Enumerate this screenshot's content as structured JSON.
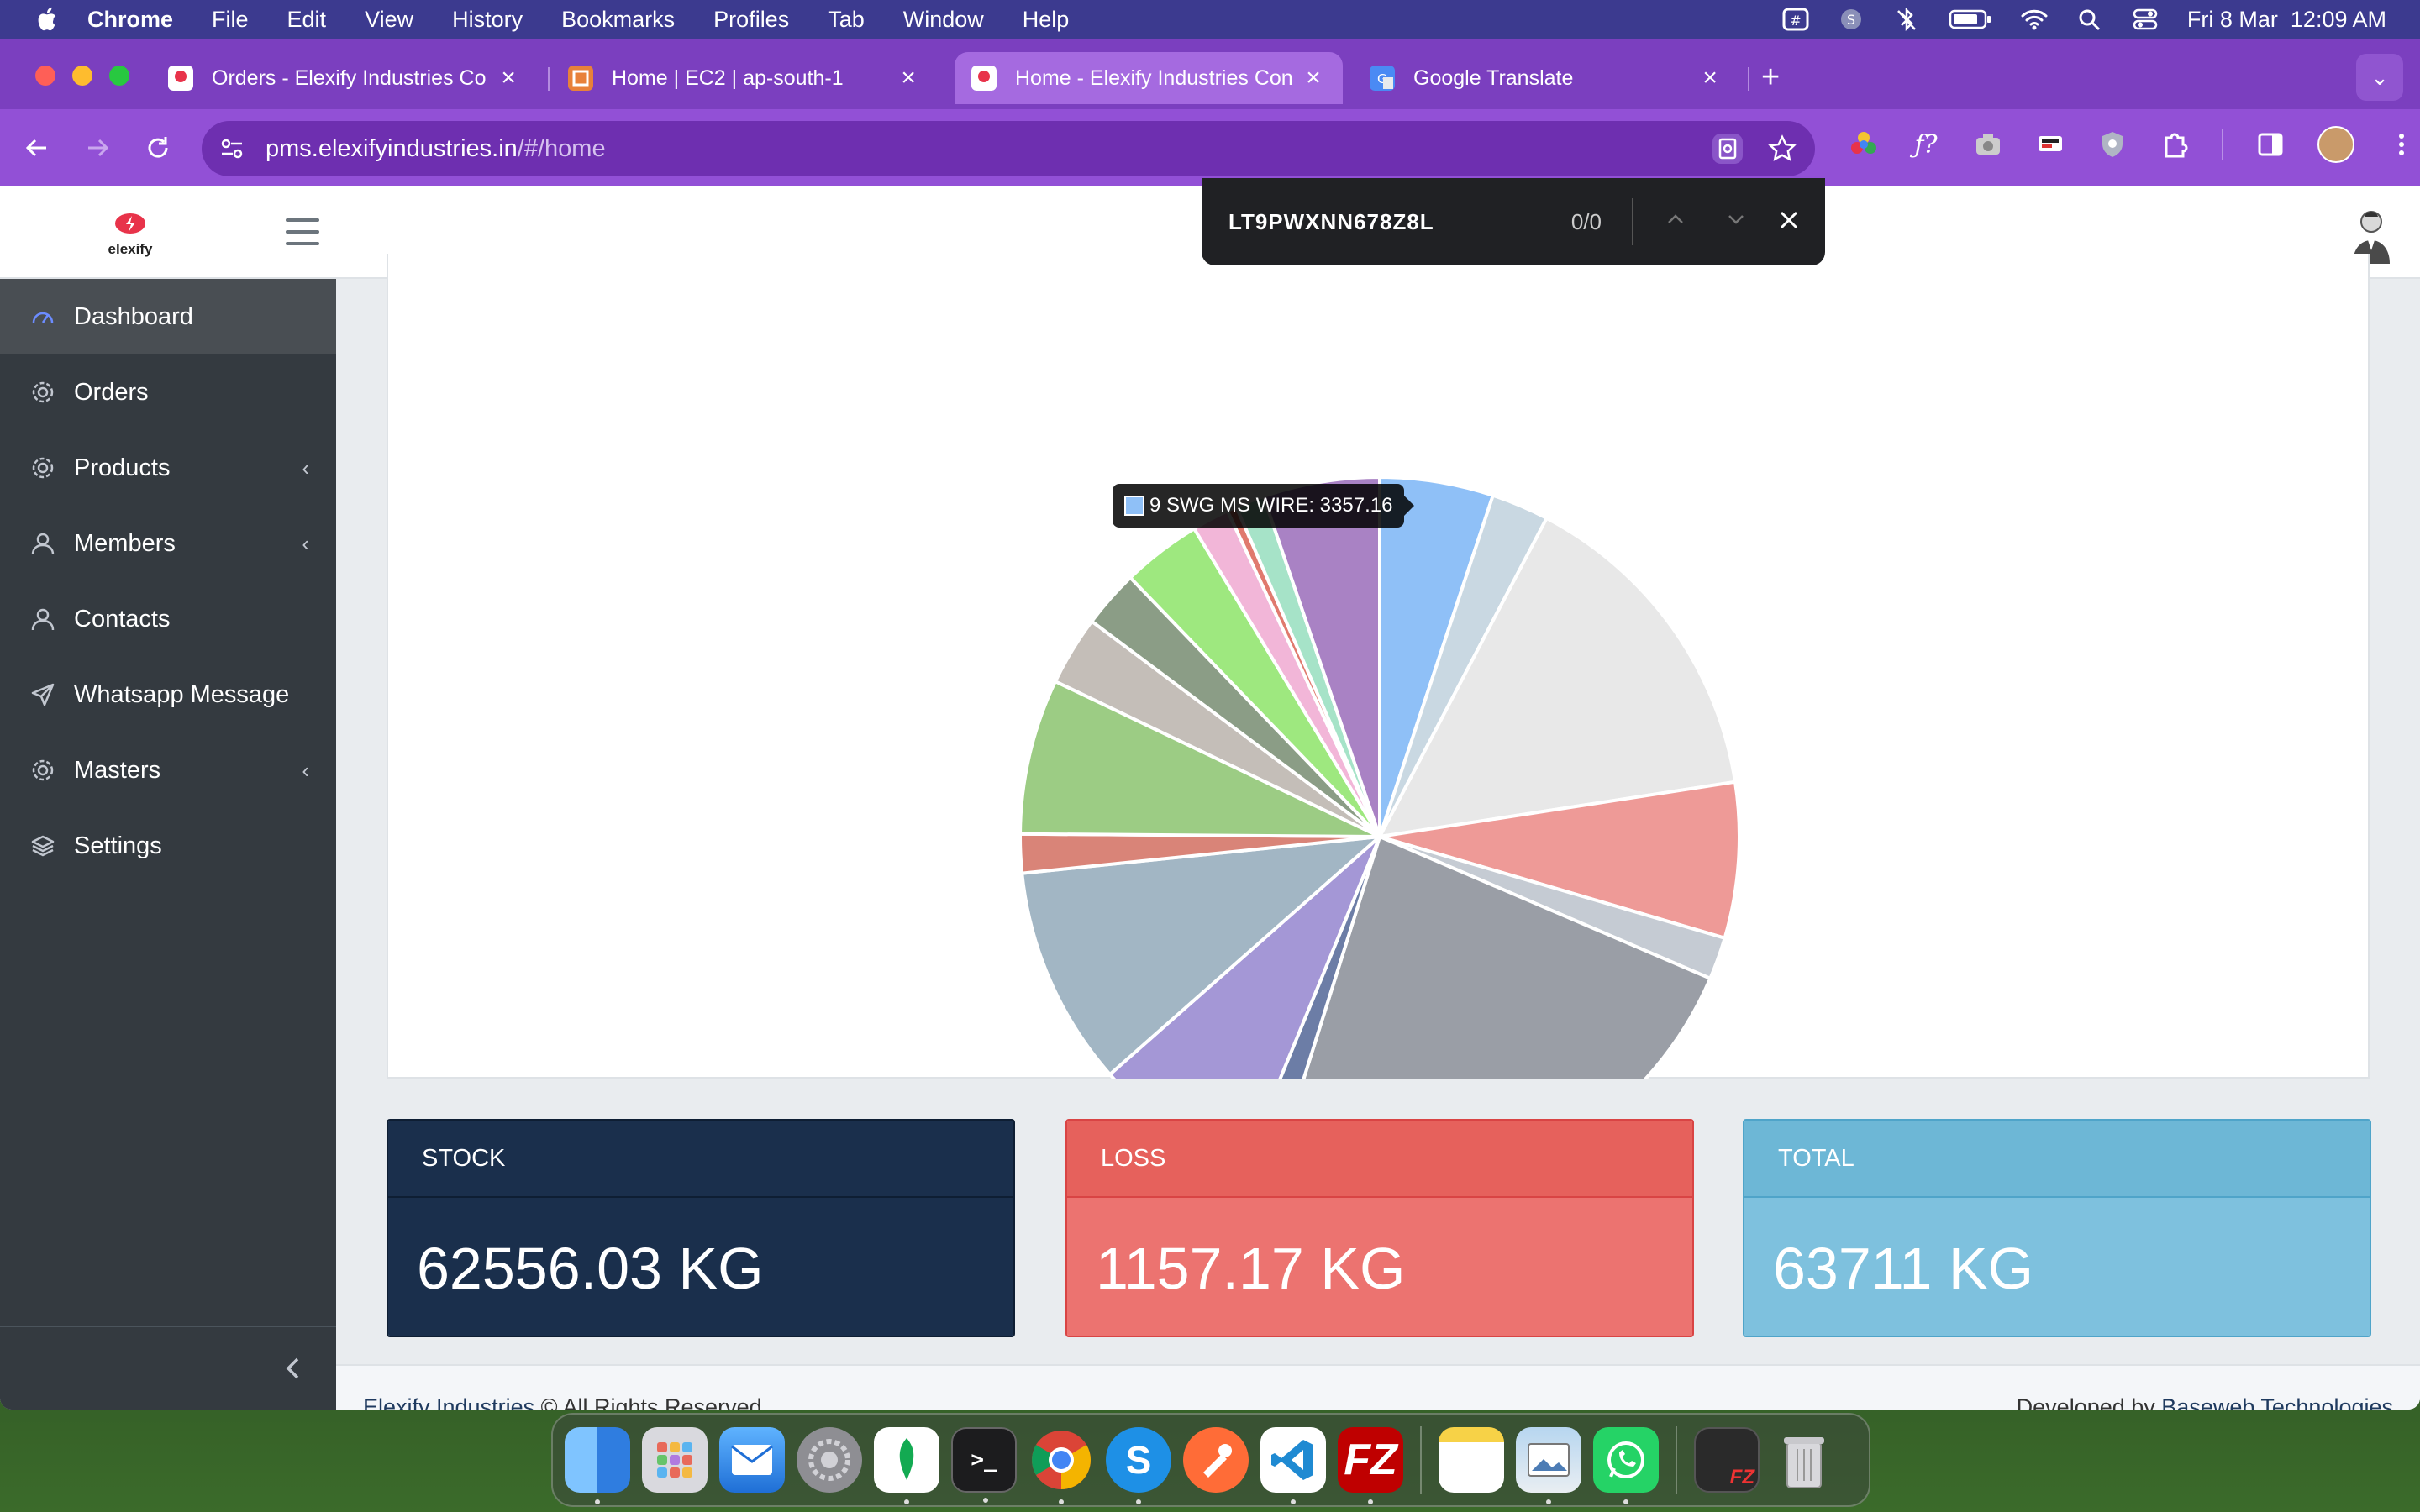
{
  "menubar": {
    "app": "Chrome",
    "items": [
      "File",
      "Edit",
      "View",
      "History",
      "Bookmarks",
      "Profiles",
      "Tab",
      "Window",
      "Help"
    ],
    "clock": "Fri 8 Mar  12:09 AM",
    "icons": [
      "input-source-icon",
      "skype-status-icon",
      "bluetooth-off-icon",
      "battery-icon",
      "wifi-icon",
      "spotlight-icon",
      "control-center-icon"
    ]
  },
  "tabs": [
    {
      "title": "Orders - Elexify Industries Co",
      "favicon": "elexify-favicon",
      "active": false
    },
    {
      "title": "Home | EC2 | ap-south-1",
      "favicon": "aws-favicon",
      "active": false
    },
    {
      "title": "Home - Elexify Industries Con",
      "favicon": "elexify-favicon",
      "active": true
    },
    {
      "title": "Google Translate",
      "favicon": "translate-favicon",
      "active": false
    }
  ],
  "omnibox": {
    "host": "pms.elexifyindustries.in",
    "path": "/#/home"
  },
  "find": {
    "query": "LT9PWXNN678Z8L",
    "count": "0/0"
  },
  "logo": {
    "text": "elexify"
  },
  "sidebar": {
    "items": [
      {
        "label": "Dashboard",
        "icon": "dashboard-icon",
        "active": true,
        "caret": false
      },
      {
        "label": "Orders",
        "icon": "gear-icon",
        "active": false,
        "caret": false
      },
      {
        "label": "Products",
        "icon": "gear-icon",
        "active": false,
        "caret": true
      },
      {
        "label": "Members",
        "icon": "user-icon",
        "active": false,
        "caret": true
      },
      {
        "label": "Contacts",
        "icon": "user-icon",
        "active": false,
        "caret": false
      },
      {
        "label": "Whatsapp Message",
        "icon": "send-icon",
        "active": false,
        "caret": false
      },
      {
        "label": "Masters",
        "icon": "gear-icon",
        "active": false,
        "caret": true
      },
      {
        "label": "Settings",
        "icon": "layers-icon",
        "active": false,
        "caret": false
      }
    ],
    "collapse_icon": "chevron-left-icon"
  },
  "chart_data": {
    "type": "pie",
    "title": "",
    "tooltip": "9 SWG MS WIRE: 3357.16",
    "slices": [
      {
        "label": "9 SWG MS WIRE",
        "value": 3357.16,
        "color": "#8fc0f7"
      },
      {
        "label": "",
        "value": 1700,
        "color": "#c9d8e2"
      },
      {
        "label": "",
        "value": 9800,
        "color": "#e8e8e8"
      },
      {
        "label": "",
        "value": 4600,
        "color": "#ee9a97"
      },
      {
        "label": "",
        "value": 1250,
        "color": "#c5cbd3"
      },
      {
        "label": "",
        "value": 15400,
        "color": "#9a9ea6"
      },
      {
        "label": "",
        "value": 900,
        "color": "#6c7da6"
      },
      {
        "label": "",
        "value": 4800,
        "color": "#a497d6"
      },
      {
        "label": "",
        "value": 6500,
        "color": "#a2b6c4"
      },
      {
        "label": "",
        "value": 1150,
        "color": "#d98478"
      },
      {
        "label": "",
        "value": 4600,
        "color": "#9ccc84"
      },
      {
        "label": "",
        "value": 2050,
        "color": "#c4beb8"
      },
      {
        "label": "",
        "value": 1700,
        "color": "#8b9d86"
      },
      {
        "label": "",
        "value": 2350,
        "color": "#9ee87f"
      },
      {
        "label": "",
        "value": 1100,
        "color": "#f2b6d8"
      },
      {
        "label": "",
        "value": 280,
        "color": "#e07a6e"
      },
      {
        "label": "",
        "value": 850,
        "color": "#a6e3c8"
      },
      {
        "label": "",
        "value": 3450,
        "color": "#a982c4"
      }
    ]
  },
  "stats": {
    "stock": {
      "label": "STOCK",
      "value": "62556.03 KG",
      "color": "#1a2f4c"
    },
    "loss": {
      "label": "LOSS",
      "value": "1157.17 KG",
      "color": "#ec7370"
    },
    "total": {
      "label": "TOTAL",
      "value": "63711 KG",
      "color": "#7ec1de"
    }
  },
  "footer": {
    "brand": "Elexify Industries",
    "rights": " © All Rights Reserved",
    "dev_prefix": "Developed by ",
    "dev_link": "Baseweb Technologies"
  },
  "dock": [
    "finder-icon",
    "launchpad-icon",
    "mail-icon",
    "system-settings-icon",
    "mongodb-compass-icon",
    "terminal-icon",
    "chrome-icon",
    "skype-icon",
    "postman-icon",
    "vscode-icon",
    "filezilla-icon",
    "notes-icon",
    "preview-icon",
    "whatsapp-icon",
    "filezilla-recent-icon",
    "trash-icon"
  ]
}
